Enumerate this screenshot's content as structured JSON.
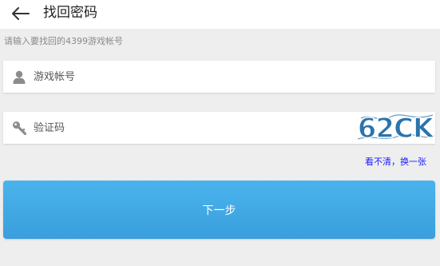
{
  "header": {
    "back_icon": "arrow-left-icon",
    "title": "找回密码"
  },
  "hint": "请输入要找回的4399游戏帐号",
  "account_field": {
    "icon": "user-icon",
    "placeholder": "游戏帐号",
    "value": ""
  },
  "code_field": {
    "icon": "key-icon",
    "placeholder": "验证码",
    "value": "",
    "captcha_text": "62CK"
  },
  "refresh_link": "看不清，换一张",
  "next_button": "下一步",
  "colors": {
    "accent": "#3fa8e4",
    "link": "#1a1aff",
    "captcha": "#2a74ad",
    "background": "#eeeeee"
  }
}
